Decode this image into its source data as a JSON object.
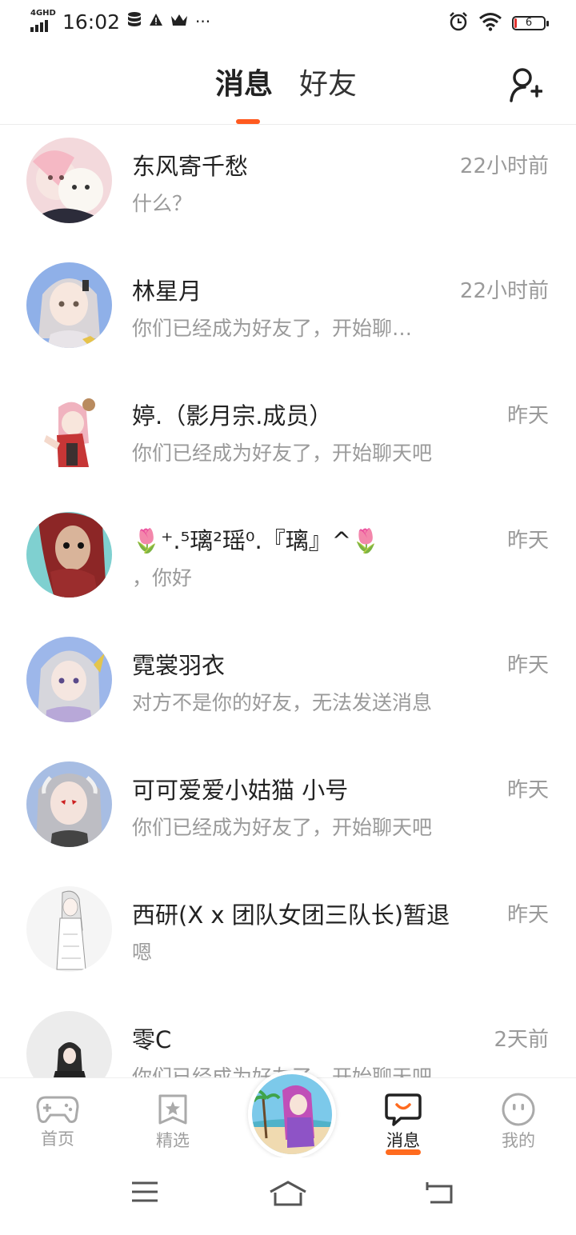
{
  "status_bar": {
    "network": "4GHD",
    "time": "16:02",
    "extra_icons": [
      "database-icon",
      "warning-icon",
      "crown-icon"
    ],
    "more": "···",
    "battery_level": "6",
    "battery_color": "#e0302d"
  },
  "header": {
    "tabs": [
      {
        "label": "消息",
        "active": true
      },
      {
        "label": "好友",
        "active": false
      }
    ],
    "accent": "#ff5a1f"
  },
  "messages": [
    {
      "name": "东风寄千愁",
      "time": "22小时前",
      "preview": "什么？"
    },
    {
      "name": "林星月",
      "time": "22小时前",
      "preview": "你们已经成为好友了，开始聊…"
    },
    {
      "name": "婷.（影月宗.成员）",
      "time": "昨天",
      "preview": "你们已经成为好友了，开始聊天吧"
    },
    {
      "name": "🌷⁺.⁵璃²瑶⁰.『璃』^🌷",
      "time": "昨天",
      "preview": "，你好"
    },
    {
      "name": "霓裳羽衣",
      "time": "昨天",
      "preview": "对方不是你的好友，无法发送消息"
    },
    {
      "name": "可可爱爱小姑猫 小号",
      "time": "昨天",
      "preview": "你们已经成为好友了，开始聊天吧"
    },
    {
      "name": "西研(X x 团队女团三队长)暂退",
      "time": "昨天",
      "preview": "嗯"
    },
    {
      "name": "零C",
      "time": "2天前",
      "preview": "你们已经成为好友了，开始聊天吧"
    }
  ],
  "bottom_nav": {
    "items": [
      {
        "label": "首页",
        "icon": "gamepad-icon"
      },
      {
        "label": "精选",
        "icon": "star-bookmark-icon"
      },
      {
        "label": "消息",
        "icon": "chat-bubble-icon",
        "active": true
      },
      {
        "label": "我的",
        "icon": "smiley-face-icon"
      }
    ]
  },
  "system_nav": {
    "icons": [
      "menu-icon",
      "home-icon",
      "back-icon"
    ]
  }
}
